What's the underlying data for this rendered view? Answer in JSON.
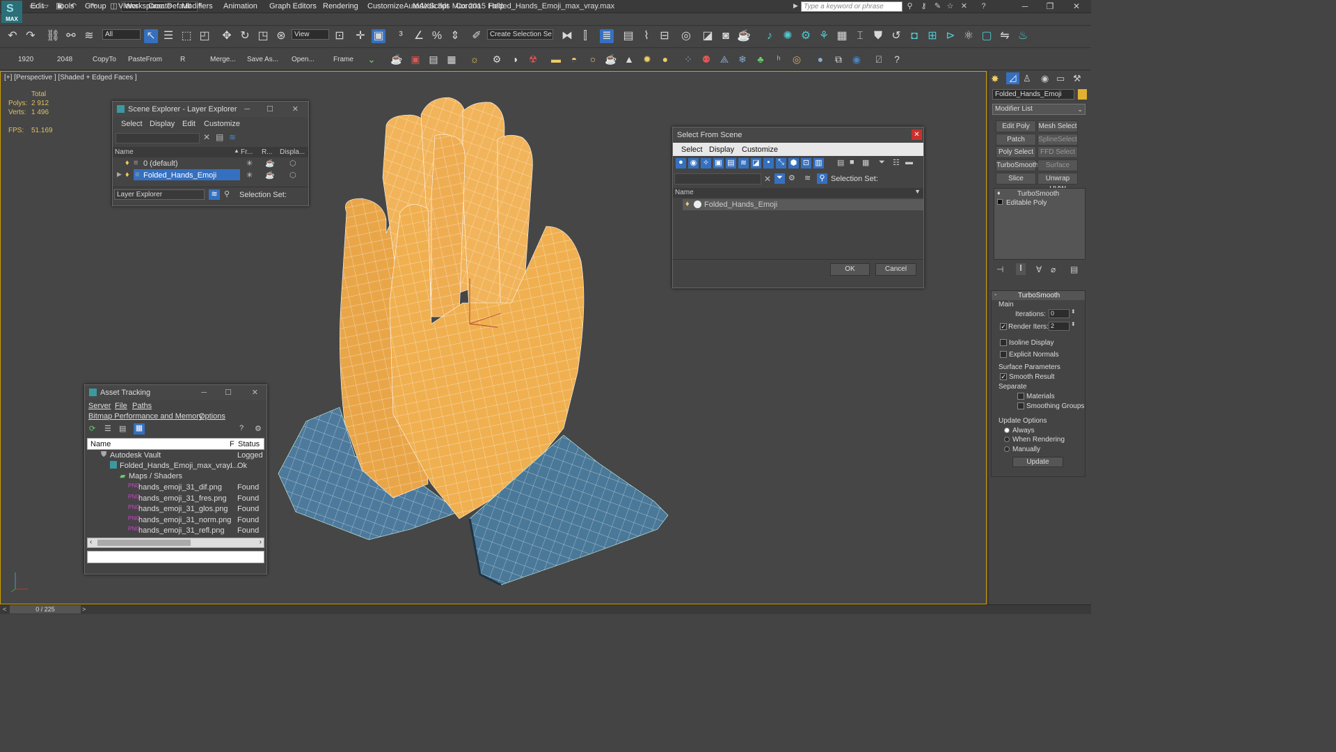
{
  "app": {
    "window_title": "Autodesk 3ds Max 2015    Folded_Hands_Emoji_max_vray.max",
    "logo_text": "MAX",
    "workspace": "Workspace: Default",
    "search_placeholder": "Type a keyword or phrase"
  },
  "menubar": [
    "Edit",
    "Tools",
    "Group",
    "Views",
    "Create",
    "Modifiers",
    "Animation",
    "Graph Editors",
    "Rendering",
    "Customize",
    "MAXScript",
    "Corona",
    "Help"
  ],
  "toolbar": {
    "selection_filter": "All",
    "ref_coord": "View",
    "selection_set": "Create Selection Se"
  },
  "toolbar2": {
    "items": [
      "1920",
      "2048",
      "CopyTo",
      "PasteFrom",
      "R",
      "Merge...",
      "Save As...",
      "Open...",
      "Frame"
    ]
  },
  "viewport": {
    "label": "[+] [Perspective ] [Shaded + Edged Faces ]",
    "stats": {
      "total_label": "Total",
      "polys_label": "Polys:",
      "polys_value": "2 912",
      "verts_label": "Verts:",
      "verts_value": "1 496",
      "fps_label": "FPS:",
      "fps_value": "51.169"
    }
  },
  "scene_explorer": {
    "title": "Scene Explorer - Layer Explorer",
    "menu": [
      "Select",
      "Display",
      "Edit",
      "Customize"
    ],
    "columns": [
      "Name",
      "Fr...",
      "R...",
      "Displa..."
    ],
    "rows": [
      {
        "name": "0 (default)"
      },
      {
        "name": "Folded_Hands_Emoji"
      }
    ],
    "footer_combo": "Layer Explorer",
    "selection_set_label": "Selection Set:"
  },
  "select_from_scene": {
    "title": "Select From Scene",
    "menu": [
      "Select",
      "Display",
      "Customize"
    ],
    "selection_set_label": "Selection Set:",
    "column_name": "Name",
    "items": [
      "Folded_Hands_Emoji"
    ],
    "ok": "OK",
    "cancel": "Cancel"
  },
  "asset_tracking": {
    "title": "Asset Tracking",
    "menu1": [
      "Server",
      "File",
      "Paths"
    ],
    "menu2": [
      "Bitmap Performance and Memory",
      "Options"
    ],
    "columns": [
      "Name",
      "F",
      "Status"
    ],
    "rows": [
      {
        "name": "Autodesk Vault",
        "flag": "",
        "status": "Logged"
      },
      {
        "name": "Folded_Hands_Emoji_max_vray....",
        "flag": "I",
        "status": "Ok"
      },
      {
        "name": "Maps / Shaders",
        "flag": "",
        "status": ""
      },
      {
        "name": "hands_emoji_31_dif.png",
        "flag": "",
        "status": "Found"
      },
      {
        "name": "hands_emoji_31_fres.png",
        "flag": "",
        "status": "Found"
      },
      {
        "name": "hands_emoji_31_glos.png",
        "flag": "",
        "status": "Found"
      },
      {
        "name": "hands_emoji_31_norm.png",
        "flag": "",
        "status": "Found"
      },
      {
        "name": "hands_emoji_31_refl.png",
        "flag": "",
        "status": "Found"
      }
    ]
  },
  "command_panel": {
    "object_name": "Folded_Hands_Emoji",
    "modifier_list": "Modifier List",
    "modifier_buttons": [
      "Edit Poly",
      "Mesh Select",
      "Patch Select",
      "SplineSelect",
      "Poly Select",
      "FFD Select",
      "TurboSmooth",
      "Surface Select",
      "Slice",
      "Unwrap UVW"
    ],
    "stack": [
      "TurboSmooth",
      "Editable Poly"
    ],
    "rollout_title": "TurboSmooth",
    "main_label": "Main",
    "iterations_label": "Iterations:",
    "iterations_value": "0",
    "render_iters_label": "Render Iters:",
    "render_iters_value": "2",
    "isoline_label": "Isoline Display",
    "explicit_normals_label": "Explicit Normals",
    "surface_params_label": "Surface Parameters",
    "smooth_result_label": "Smooth Result",
    "separate_label": "Separate",
    "materials_label": "Materials",
    "smoothing_groups_label": "Smoothing Groups",
    "update_options_label": "Update Options",
    "always_label": "Always",
    "when_rendering_label": "When Rendering",
    "manually_label": "Manually",
    "update_button": "Update"
  },
  "status": {
    "frame": "0 / 225"
  },
  "colors": {
    "hand": "#f0b050",
    "cuff": "#4d7a9c",
    "selection": "#3570c0",
    "accent_frame": "#d0a000"
  }
}
